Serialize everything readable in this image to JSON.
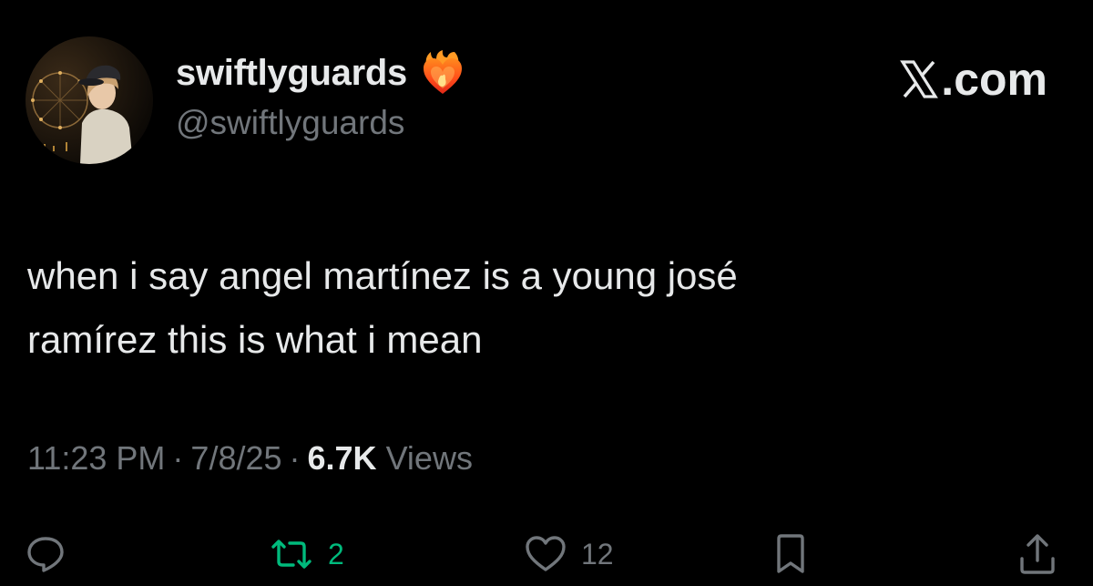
{
  "user": {
    "display_name": "swiftlyguards",
    "handle": "@swiftlyguards",
    "badge_icon": "heart-on-fire-icon"
  },
  "brand": {
    "label": ".com",
    "logo_icon": "x-logo-icon"
  },
  "tweet": {
    "text_line1": "when i say angel martínez is a young josé",
    "text_line2": "ramírez this is what i mean"
  },
  "meta": {
    "time": "11:23 PM",
    "separator": "·",
    "date": "7/8/25",
    "views_count": "6.7K",
    "views_label": "Views"
  },
  "actions": {
    "reply": {
      "icon": "reply-icon",
      "count": ""
    },
    "retweet": {
      "icon": "retweet-icon",
      "count": "2"
    },
    "like": {
      "icon": "heart-outline-icon",
      "count": "12"
    },
    "bookmark": {
      "icon": "bookmark-icon",
      "count": ""
    },
    "share": {
      "icon": "share-icon",
      "count": ""
    }
  },
  "colors": {
    "background": "#000000",
    "text_primary": "#e7e9ea",
    "text_secondary": "#71767b",
    "retweet_active": "#00ba7c"
  }
}
